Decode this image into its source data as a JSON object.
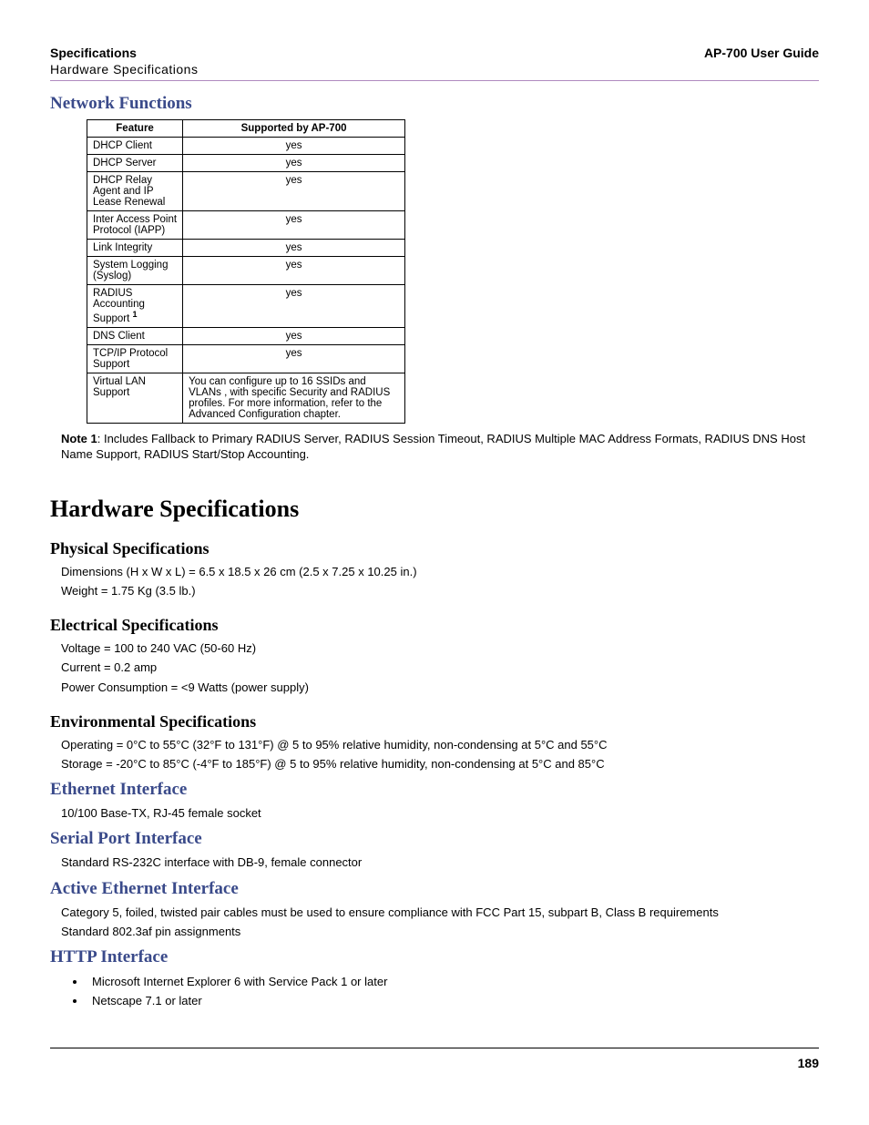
{
  "header": {
    "left_top": "Specifications",
    "right_top": "AP-700 User Guide",
    "left_sub": "Hardware Specifications"
  },
  "section_network_functions": "Network Functions",
  "table": {
    "col1": "Feature",
    "col2": "Supported by AP-700",
    "rows": [
      {
        "feature": "DHCP Client",
        "supported": "yes"
      },
      {
        "feature": "DHCP Server",
        "supported": "yes"
      },
      {
        "feature": "DHCP Relay Agent and IP Lease Renewal",
        "supported": "yes"
      },
      {
        "feature": "Inter Access Point Protocol (IAPP)",
        "supported": "yes"
      },
      {
        "feature": "Link Integrity",
        "supported": "yes"
      },
      {
        "feature": "System Logging (Syslog)",
        "supported": "yes"
      },
      {
        "feature": "RADIUS Accounting Support",
        "sup": "1",
        "supported": "yes"
      },
      {
        "feature": "DNS Client",
        "supported": "yes"
      },
      {
        "feature": "TCP/IP Protocol Support",
        "supported": "yes"
      },
      {
        "feature": "Virtual LAN Support",
        "supported": "You can configure up to 16 SSIDs and VLANs , with specific Security and RADIUS profiles. For more information, refer to the Advanced Configuration chapter."
      }
    ]
  },
  "note_label": "Note 1",
  "note_text": ": Includes Fallback to Primary RADIUS Server, RADIUS Session Timeout, RADIUS Multiple MAC Address Formats, RADIUS DNS Host Name Support, RADIUS Start/Stop Accounting.",
  "section_hardware": "Hardware Specifications",
  "sub_physical": "Physical Specifications",
  "physical_lines": [
    "Dimensions (H x W x L) = 6.5 x 18.5 x 26 cm (2.5 x 7.25 x 10.25 in.)",
    "Weight = 1.75 Kg (3.5 lb.)"
  ],
  "sub_electrical": "Electrical Specifications",
  "electrical_lines": [
    "Voltage = 100 to 240 VAC (50-60 Hz)",
    "Current = 0.2 amp",
    "Power Consumption = <9 Watts (power supply)"
  ],
  "sub_environmental": "Environmental Specifications",
  "environmental_lines": [
    "Operating = 0°C to 55°C (32°F to 131°F) @ 5 to 95% relative humidity, non-condensing at 5°C and 55°C",
    "Storage = -20°C to 85°C (-4°F to 185°F) @ 5 to 95% relative humidity, non-condensing at 5°C and 85°C"
  ],
  "section_ethernet": "Ethernet Interface",
  "ethernet_line": "10/100 Base-TX, RJ-45 female socket",
  "section_serial": "Serial Port Interface",
  "serial_line": "Standard RS-232C interface with DB-9, female connector",
  "section_active_ethernet": "Active Ethernet Interface",
  "active_ethernet_lines": [
    "Category 5, foiled, twisted pair cables must be used to ensure compliance with FCC Part 15, subpart B, Class B requirements",
    "Standard 802.3af pin assignments"
  ],
  "section_http": "HTTP Interface",
  "http_items": [
    "Microsoft Internet Explorer 6 with Service Pack 1 or later",
    "Netscape 7.1 or later"
  ],
  "page_number": "189"
}
